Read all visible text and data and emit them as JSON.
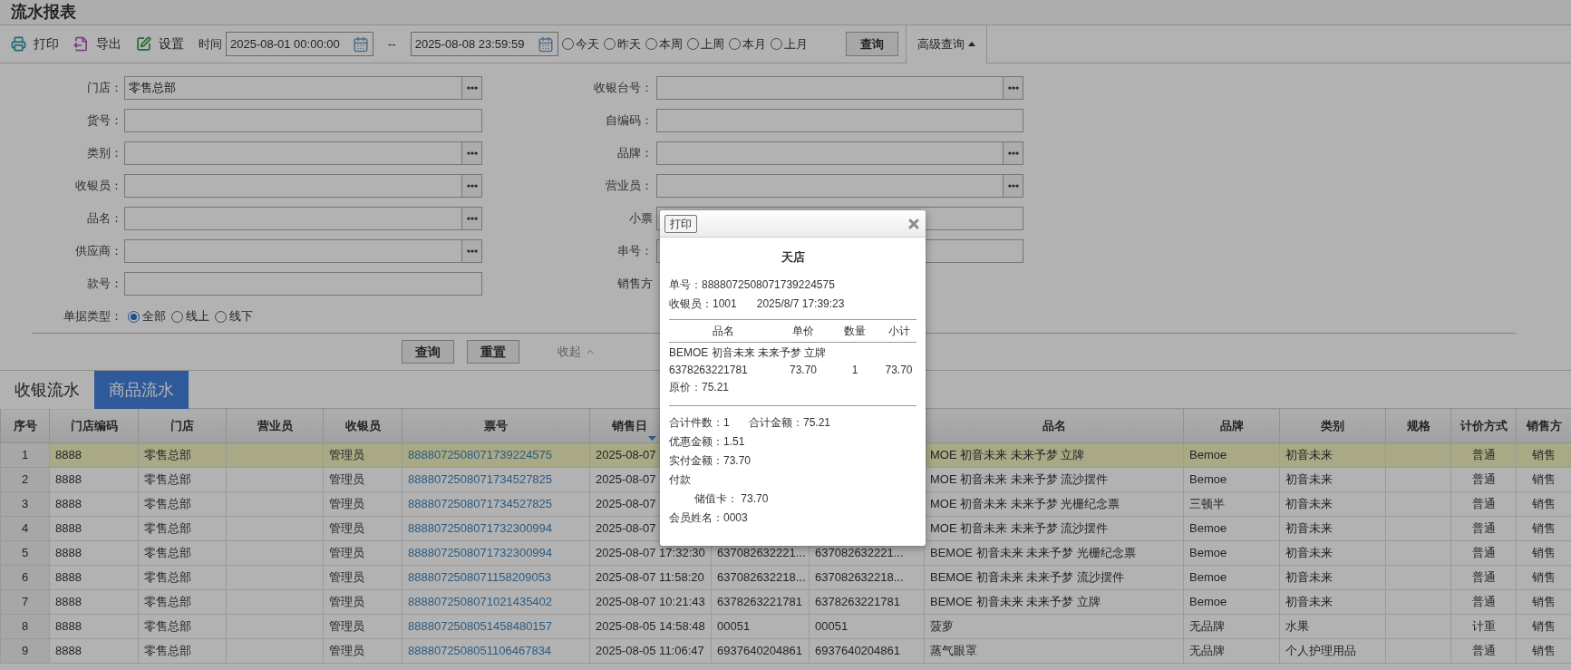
{
  "page_title": "流水报表",
  "toolbar": {
    "actions": [
      {
        "kind": "print",
        "label": "打印"
      },
      {
        "kind": "export",
        "label": "导出"
      },
      {
        "kind": "settings",
        "label": "设置"
      }
    ],
    "time_label": "时间",
    "start": "2025-08-01 00:00:00",
    "separator": "--",
    "end": "2025-08-08 23:59:59",
    "ranges": [
      {
        "label": "今天",
        "selected": false
      },
      {
        "label": "昨天",
        "selected": false
      },
      {
        "label": "本周",
        "selected": false
      },
      {
        "label": "上周",
        "selected": false
      },
      {
        "label": "本月",
        "selected": false
      },
      {
        "label": "上月",
        "selected": false
      }
    ],
    "query": "查询",
    "advanced": {
      "label": "高级查询",
      "expanded": true
    }
  },
  "filters": {
    "rows": [
      {
        "left": {
          "label": "门店：",
          "value": "零售总部",
          "kind": "picker"
        },
        "right": {
          "label": "收银台号：",
          "kind": "picker"
        }
      },
      {
        "left": {
          "label": "货号：",
          "kind": "text"
        },
        "right": {
          "label": "自编码：",
          "kind": "text"
        }
      },
      {
        "left": {
          "label": "类别：",
          "kind": "picker"
        },
        "right": {
          "label": "品牌：",
          "kind": "picker"
        }
      },
      {
        "left": {
          "label": "收银员：",
          "kind": "picker"
        },
        "right": {
          "label": "营业员：",
          "kind": "picker"
        }
      },
      {
        "left": {
          "label": "品名：",
          "kind": "picker"
        },
        "right": {
          "label": "小票",
          "kind": "text"
        }
      },
      {
        "left": {
          "label": "供应商：",
          "kind": "picker"
        },
        "right": {
          "label": "串号：",
          "kind": "text"
        }
      },
      {
        "left": {
          "label": "款号：",
          "kind": "text"
        },
        "right": {
          "label": "销售方",
          "kind": "none"
        }
      }
    ],
    "doc_type": {
      "label": "单据类型：",
      "options": [
        {
          "label": "全部",
          "selected": true
        },
        {
          "label": "线上",
          "selected": false
        },
        {
          "label": "线下",
          "selected": false
        }
      ]
    },
    "buttons": [
      "查询",
      "重置"
    ],
    "collapse": "收起"
  },
  "tabs": [
    {
      "label": "收银流水",
      "selected": false
    },
    {
      "label": "商品流水",
      "selected": true
    }
  ],
  "table": {
    "columns": [
      {
        "label": "序号",
        "sorted": false
      },
      {
        "label": "门店编码",
        "sorted": false
      },
      {
        "label": "门店",
        "sorted": false
      },
      {
        "label": "营业员",
        "sorted": false
      },
      {
        "label": "收银员",
        "sorted": false
      },
      {
        "label": "票号",
        "sorted": false
      },
      {
        "label": "销售日",
        "sorted": true
      },
      {
        "label": "品名",
        "sorted": false
      },
      {
        "label": "品牌",
        "sorted": false
      },
      {
        "label": "类别",
        "sorted": false
      },
      {
        "label": "规格",
        "sorted": false
      },
      {
        "label": "计价方式",
        "sorted": false
      },
      {
        "label": "销售方",
        "sorted": false
      }
    ],
    "rows": [
      {
        "selected": true,
        "seq": "1",
        "store_code": "8888",
        "store": "零售总部",
        "cashier": "管理员",
        "ticket": "8888072508071739224575",
        "sale_time": "2025-08-07",
        "product": "MOE 初音未来 未来予梦 立牌",
        "brand": "Bemoe",
        "category": "初音未来",
        "pricing": "普通",
        "sale_type": "销售"
      },
      {
        "selected": false,
        "seq": "2",
        "store_code": "8888",
        "store": "零售总部",
        "cashier": "管理员",
        "ticket": "8888072508071734527825",
        "sale_time": "2025-08-07",
        "product": "MOE 初音未来 未来予梦 流沙摆件",
        "brand": "Bemoe",
        "category": "初音未来",
        "pricing": "普通",
        "sale_type": "销售"
      },
      {
        "selected": false,
        "seq": "3",
        "store_code": "8888",
        "store": "零售总部",
        "cashier": "管理员",
        "ticket": "8888072508071734527825",
        "sale_time": "2025-08-07",
        "product": "MOE 初音未来 未来予梦 光栅纪念票",
        "brand": "三顿半",
        "category": "初音未来",
        "pricing": "普通",
        "sale_type": "销售"
      },
      {
        "selected": false,
        "seq": "4",
        "store_code": "8888",
        "store": "零售总部",
        "cashier": "管理员",
        "ticket": "8888072508071732300994",
        "sale_time": "2025-08-07",
        "product": "MOE 初音未来 未来予梦 流沙摆件",
        "brand": "Bemoe",
        "category": "初音未来",
        "pricing": "普通",
        "sale_type": "销售"
      },
      {
        "selected": false,
        "seq": "5",
        "store_code": "8888",
        "store": "零售总部",
        "cashier": "管理员",
        "ticket": "8888072508071732300994",
        "sale_time": "2025-08-07 17:32:30",
        "column_8": "637082632221...",
        "column_9": "637082632221...",
        "product": "BEMOE 初音未来 未来予梦 光栅纪念票",
        "brand": "Bemoe",
        "category": "初音未来",
        "pricing": "普通",
        "sale_type": "销售"
      },
      {
        "selected": false,
        "seq": "6",
        "store_code": "8888",
        "store": "零售总部",
        "cashier": "管理员",
        "ticket": "8888072508071158209053",
        "sale_time": "2025-08-07 11:58:20",
        "column_8": "637082632218...",
        "column_9": "637082632218...",
        "product": "BEMOE 初音未来 未来予梦 流沙摆件",
        "brand": "Bemoe",
        "category": "初音未来",
        "pricing": "普通",
        "sale_type": "销售"
      },
      {
        "selected": false,
        "seq": "7",
        "store_code": "8888",
        "store": "零售总部",
        "cashier": "管理员",
        "ticket": "8888072508071021435402",
        "sale_time": "2025-08-07 10:21:43",
        "column_8": "6378263221781",
        "column_9": "6378263221781",
        "product": "BEMOE 初音未来 未来予梦 立牌",
        "brand": "Bemoe",
        "category": "初音未来",
        "pricing": "普通",
        "sale_type": "销售"
      },
      {
        "selected": false,
        "seq": "8",
        "store_code": "8888",
        "store": "零售总部",
        "cashier": "管理员",
        "ticket": "8888072508051458480157",
        "sale_time": "2025-08-05 14:58:48",
        "column_8": "00051",
        "column_9": "00051",
        "product": "菠萝",
        "brand": "无品牌",
        "category": "水果",
        "pricing": "计重",
        "sale_type": "销售"
      },
      {
        "selected": false,
        "seq": "9",
        "store_code": "8888",
        "store": "零售总部",
        "cashier": "管理员",
        "ticket": "8888072508051106467834",
        "sale_time": "2025-08-05 11:06:47",
        "column_8": "6937640204861",
        "column_9": "6937640204861",
        "product": "蒸气眼罩",
        "brand": "无品牌",
        "category": "个人护理用品",
        "pricing": "普通",
        "sale_type": "销售"
      }
    ]
  },
  "dialog": {
    "print": "打印",
    "title": "天店",
    "order_no": "单号：8888072508071739224575",
    "cashier": "收银员：1001",
    "time": "2025/8/7 17:39:23",
    "item_columns": [
      "品名",
      "单价",
      "数量",
      "小计"
    ],
    "items": [
      {
        "name": "BEMOE 初音未来 未来予梦 立牌",
        "code": "6378263221781",
        "price": "73.70",
        "qty": "1",
        "subtotal": "73.70",
        "original": "原价：75.21"
      }
    ],
    "total_count": "合计件数：1",
    "total_amount": "合计金额：75.21",
    "discount": "优惠金额：1.51",
    "paid": "实付金额：73.70",
    "payment_label": "付款",
    "payments": [
      "储值卡： 73.70"
    ],
    "member": "会员姓名：0003"
  }
}
